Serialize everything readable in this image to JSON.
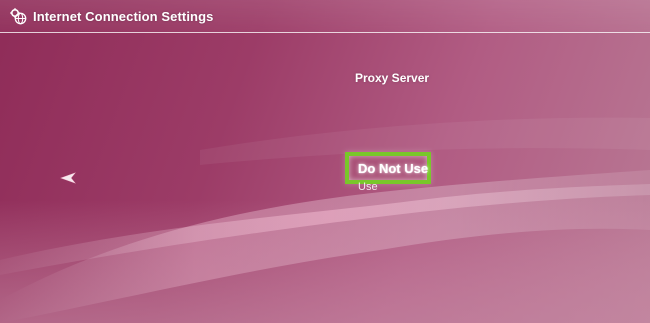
{
  "header": {
    "title": "Internet Connection Settings",
    "icon": "internet-settings-icon"
  },
  "setting": {
    "label": "Proxy Server"
  },
  "options": [
    {
      "label": "Do Not Use",
      "selected": true
    },
    {
      "label": "Use",
      "selected": false
    }
  ],
  "colors": {
    "background": "#9c3c67",
    "selection_border": "#79c72a",
    "text": "#ffffff"
  },
  "icons": {
    "back": "back-arrow-icon"
  }
}
